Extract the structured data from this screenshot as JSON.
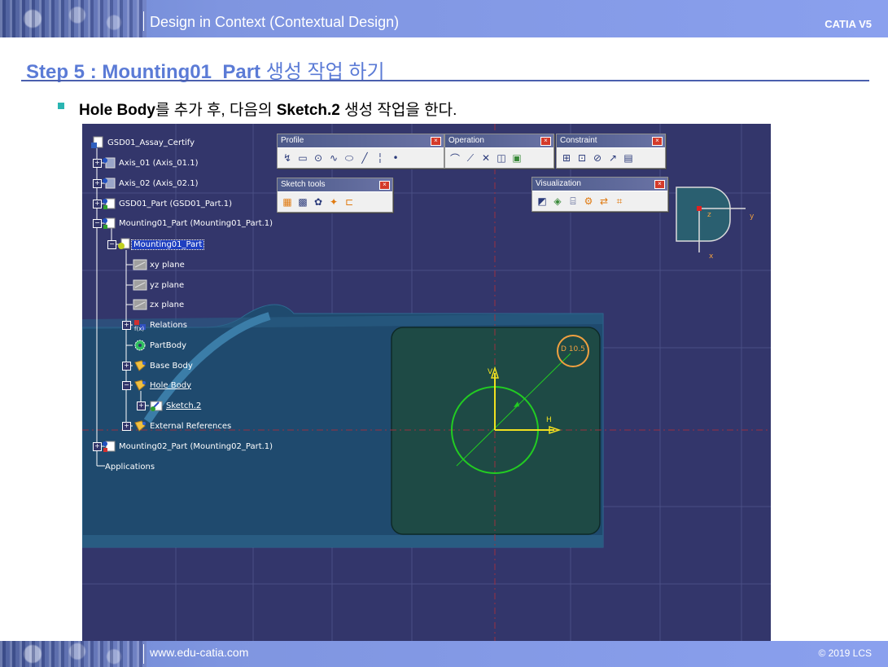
{
  "header": {
    "title": "Design in Context (Contextual Design)",
    "product": "CATIA V5"
  },
  "footer": {
    "website": "www.edu-catia.com",
    "copyright": "© 2019 LCS"
  },
  "step": {
    "title_en": "Step 5 : Mounting01_Part",
    "title_kr": " 생성 작업 하기"
  },
  "bullet": {
    "part1": "Hole Body",
    "part2": "를 추가 후, 다음의 ",
    "part3": "Sketch.2",
    "part4": " 생성 작업을 한다."
  },
  "tree": [
    {
      "label": "GSD01_Assay_Certify",
      "icon": "product-icon"
    },
    {
      "label": "Axis_01 (Axis_01.1)",
      "icon": "component-icon"
    },
    {
      "label": "Axis_02 (Axis_02.1)",
      "icon": "component-icon"
    },
    {
      "label": "GSD01_Part (GSD01_Part.1)",
      "icon": "component-icon"
    },
    {
      "label": "Mounting01_Part (Mounting01_Part.1)",
      "icon": "component-icon"
    },
    {
      "label": "Mounting01_Part",
      "icon": "part-icon"
    },
    {
      "label": "xy plane",
      "icon": "plane-icon"
    },
    {
      "label": "yz plane",
      "icon": "plane-icon"
    },
    {
      "label": "zx plane",
      "icon": "plane-icon"
    },
    {
      "label": "Relations",
      "icon": "relations-icon"
    },
    {
      "label": "PartBody",
      "icon": "gear-icon"
    },
    {
      "label": "Base Body",
      "icon": "body-icon"
    },
    {
      "label": "Hole Body",
      "icon": "body-icon"
    },
    {
      "label": "Sketch.2",
      "icon": "sketch-icon"
    },
    {
      "label": "External References",
      "icon": "body-icon"
    },
    {
      "label": "Mounting02_Part (Mounting02_Part.1)",
      "icon": "component-icon"
    },
    {
      "label": "Applications",
      "icon": ""
    }
  ],
  "toolbars": {
    "profile": "Profile",
    "operation": "Operation",
    "constraint": "Constraint",
    "sketch_tools": "Sketch tools",
    "visualization": "Visualization",
    "close": "×"
  },
  "sketch": {
    "dimension": "D 10.5",
    "h_axis": "H",
    "v_axis": "V"
  },
  "compass": {
    "z": "z",
    "y": "y",
    "x": "x"
  },
  "colors": {
    "canvas": "#33366b",
    "part": "#1f4a6e",
    "pad": "#1e4a45",
    "circle": "#22cc22",
    "dimension": "#f0a040"
  }
}
